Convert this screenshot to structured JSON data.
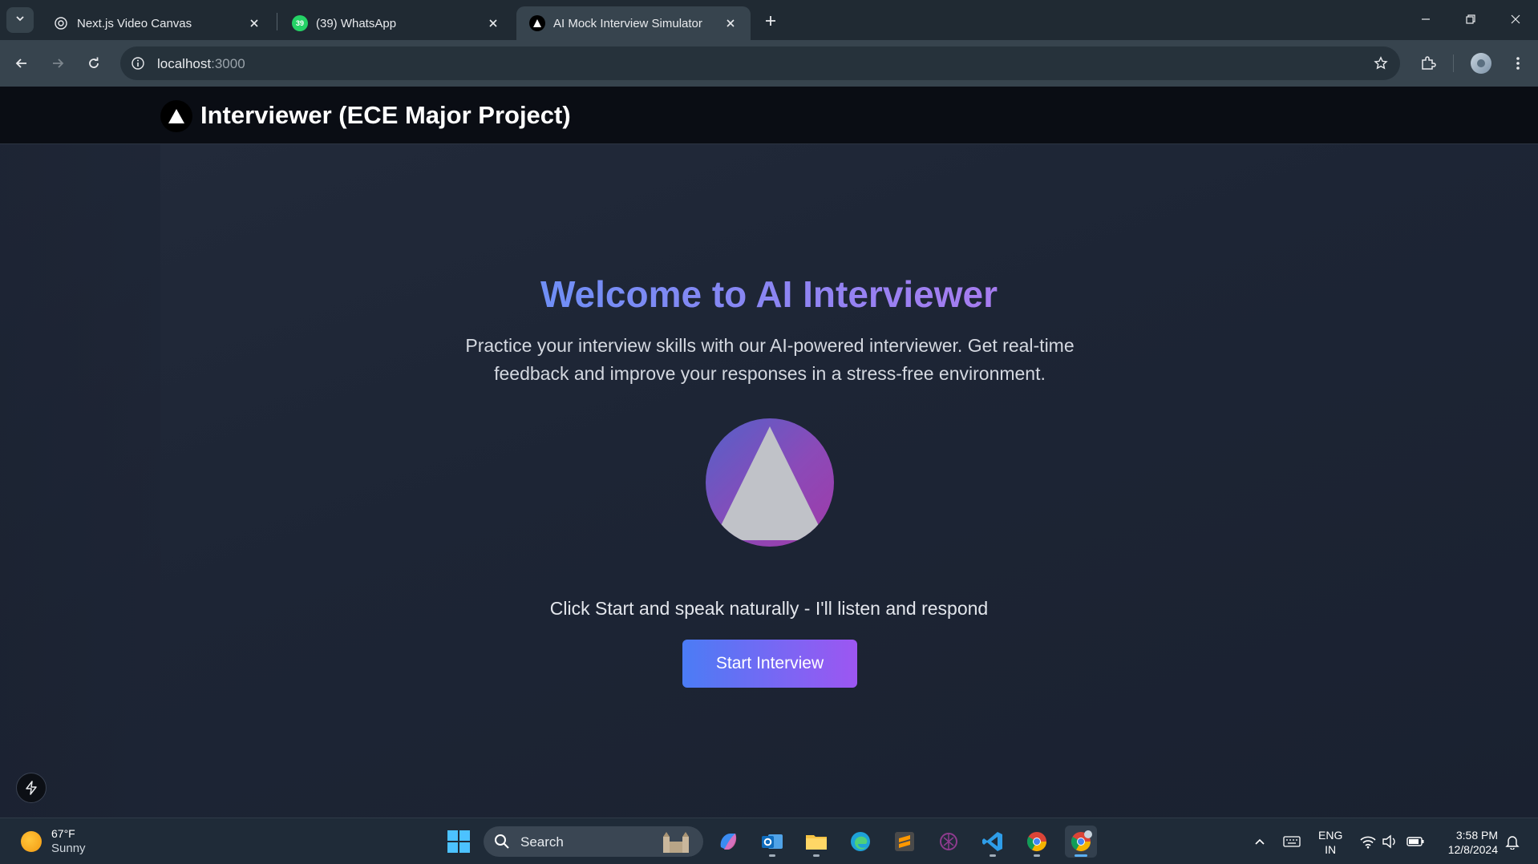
{
  "browser": {
    "tabs": [
      {
        "title": "Next.js Video Canvas",
        "active": false
      },
      {
        "title": "(39) WhatsApp",
        "badge": "39",
        "active": false
      },
      {
        "title": "AI Mock Interview Simulator",
        "active": true
      }
    ],
    "address": {
      "host": "localhost",
      "port": ":3000"
    }
  },
  "app": {
    "title": "Interviewer (ECE Major Project)",
    "hero_title": "Welcome to AI Interviewer",
    "hero_description": "Practice your interview skills with our AI-powered interviewer. Get real-time feedback and improve your responses in a stress-free environment.",
    "prompt": "Click Start and speak naturally - I'll listen and respond",
    "start_button": "Start Interview"
  },
  "taskbar": {
    "weather": {
      "temp": "67°F",
      "condition": "Sunny"
    },
    "search_label": "Search",
    "language": {
      "lang": "ENG",
      "region": "IN"
    },
    "time": "3:58 PM",
    "date": "12/8/2024"
  },
  "colors": {
    "accent_start": "#4b7cf5",
    "accent_end": "#9d56f2",
    "header_bg": "#0a0d14",
    "page_bg": "#1d2535"
  }
}
